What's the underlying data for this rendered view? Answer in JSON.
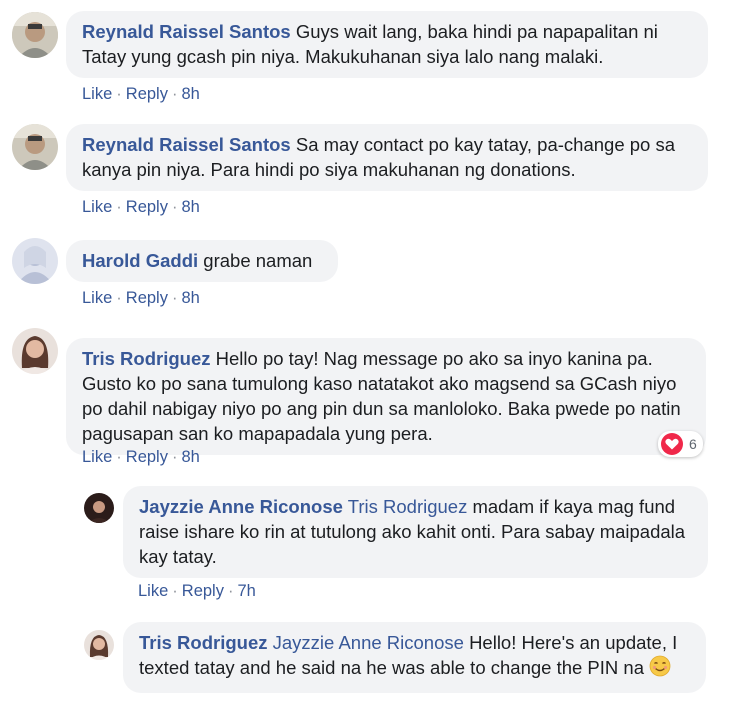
{
  "comments": [
    {
      "author": "Reynald Raissel Santos",
      "text": "Guys wait lang, baka hindi pa napapalitan ni Tatay yung gcash pin niya. Makukuhanan siya lalo nang malaki.",
      "like": "Like",
      "reply": "Reply",
      "time": "8h"
    },
    {
      "author": "Reynald Raissel Santos",
      "text": "Sa may contact po kay tatay, pa-change po sa kanya pin niya. Para hindi po siya makuhanan ng donations.",
      "like": "Like",
      "reply": "Reply",
      "time": "8h"
    },
    {
      "author": "Harold Gaddi",
      "text": "grabe naman",
      "like": "Like",
      "reply": "Reply",
      "time": "8h"
    },
    {
      "author": "Tris Rodriguez",
      "text": "Hello po tay! Nag message po ako sa inyo kanina pa. Gusto ko po sana tumulong kaso natatakot ako magsend sa GCash niyo po dahil nabigay niyo po ang pin dun sa manloloko. Baka pwede po natin pagusapan san ko mapapadala yung pera.",
      "like": "Like",
      "reply": "Reply",
      "time": "8h",
      "reaction_count": "6",
      "reaction_icon": "heart-icon",
      "reaction_color": "#f0284a"
    }
  ],
  "replies": [
    {
      "author": "Jayzzie Anne Riconose",
      "mention": "Tris Rodriguez",
      "text": "madam if kaya mag fund raise ishare ko rin at tutulong ako kahit onti. Para sabay maipadala kay tatay.",
      "like": "Like",
      "reply": "Reply",
      "time": "7h"
    },
    {
      "author": "Tris Rodriguez",
      "mention": "Jayzzie Anne Riconose",
      "text": "Hello! Here's an update, I texted tatay and he said na he was able to change the PIN na",
      "emoji": "smiling-face-emoji"
    }
  ],
  "colors": {
    "link": "#385898",
    "bubble": "#f2f3f5",
    "text": "#1c1e21",
    "separator": "#90949c"
  }
}
